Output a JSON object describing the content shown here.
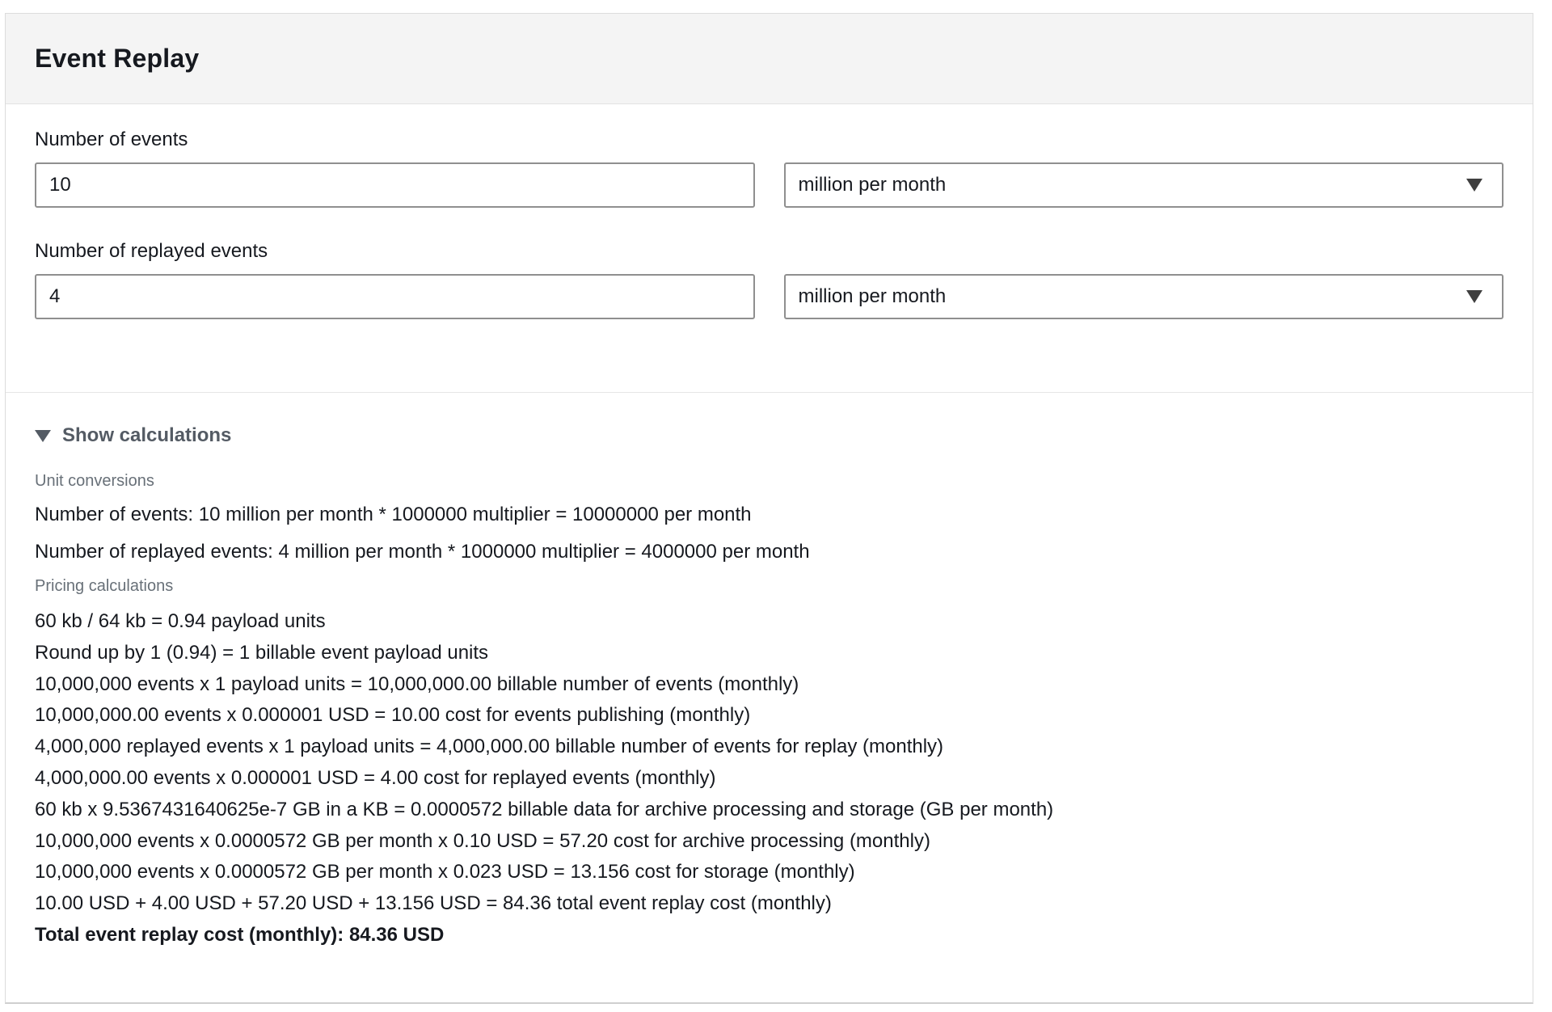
{
  "panel": {
    "title": "Event Replay"
  },
  "fields": [
    {
      "label": "Number of events",
      "value": "10",
      "unit": "million per month"
    },
    {
      "label": "Number of replayed events",
      "value": "4",
      "unit": "million per month"
    }
  ],
  "calculations": {
    "toggle_label": "Show calculations",
    "expanded": true,
    "unit_conversions": {
      "heading": "Unit conversions",
      "lines": [
        "Number of events: 10 million per month * 1000000 multiplier = 10000000 per month",
        "Number of replayed events: 4 million per month * 1000000 multiplier = 4000000 per month"
      ]
    },
    "pricing": {
      "heading": "Pricing calculations",
      "lines": [
        "60 kb / 64 kb = 0.94 payload units",
        "Round up by 1 (0.94) = 1 billable event payload units",
        "10,000,000 events x 1 payload units = 10,000,000.00 billable number of events (monthly)",
        "10,000,000.00 events x 0.000001 USD = 10.00 cost for events publishing (monthly)",
        "4,000,000 replayed events x 1 payload units = 4,000,000.00 billable number of events for replay (monthly)",
        "4,000,000.00 events x 0.000001 USD = 4.00 cost for replayed events (monthly)",
        "60 kb x 9.5367431640625e-7 GB in a KB = 0.0000572 billable data for archive processing and storage (GB per month)",
        "10,000,000 events x 0.0000572 GB per month x 0.10 USD = 57.20 cost for archive processing (monthly)",
        "10,000,000 events x 0.0000572 GB per month x 0.023 USD = 13.156 cost for storage (monthly)",
        "10.00 USD + 4.00 USD + 57.20 USD + 13.156 USD = 84.36 total event replay cost (monthly)"
      ],
      "total": "Total event replay cost (monthly): 84.36 USD"
    }
  }
}
